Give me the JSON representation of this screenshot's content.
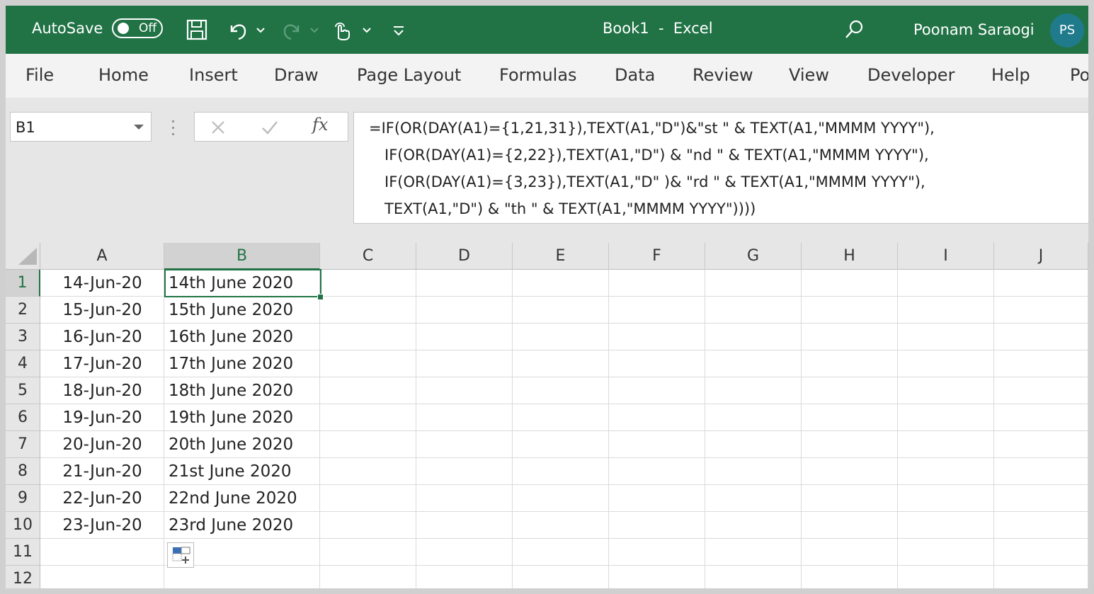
{
  "titlebar": {
    "autosave_label": "AutoSave",
    "autosave_state": "Off",
    "doc_title": "Book1  -  Excel",
    "user_name": "Poonam Saraogi",
    "user_initials": "PS",
    "icons": [
      "save-icon",
      "undo-icon",
      "redo-icon",
      "touch-mode-icon",
      "customize-toolbar-icon",
      "search-icon"
    ]
  },
  "ribbon": {
    "tabs": [
      "File",
      "Home",
      "Insert",
      "Draw",
      "Page Layout",
      "Formulas",
      "Data",
      "Review",
      "View",
      "Developer",
      "Help",
      "Po"
    ]
  },
  "formula_bar": {
    "name_box": "B1",
    "fx_label": "fx",
    "lines": [
      "=IF(OR(DAY(A1)={1,21,31}),TEXT(A1,\"D\")&\"st \" & TEXT(A1,\"MMMM YYYY\"),",
      "IF(OR(DAY(A1)={2,22}),TEXT(A1,\"D\") & \"nd \" & TEXT(A1,\"MMMM YYYY\"),",
      "IF(OR(DAY(A1)={3,23}),TEXT(A1,\"D\" )& \"rd \" & TEXT(A1,\"MMMM YYYY\"),",
      "TEXT(A1,\"D\") & \"th \" & TEXT(A1,\"MMMM YYYY\"))))"
    ]
  },
  "sheet": {
    "columns": [
      "A",
      "B",
      "C",
      "D",
      "E",
      "F",
      "G",
      "H",
      "I",
      "J"
    ],
    "rows": [
      "1",
      "2",
      "3",
      "4",
      "5",
      "6",
      "7",
      "8",
      "9",
      "10",
      "11",
      "12"
    ],
    "selected_cell": "B1",
    "col_a": [
      "14-Jun-20",
      "15-Jun-20",
      "16-Jun-20",
      "17-Jun-20",
      "18-Jun-20",
      "19-Jun-20",
      "20-Jun-20",
      "21-Jun-20",
      "22-Jun-20",
      "23-Jun-20"
    ],
    "col_b": [
      "14th June 2020",
      "15th June 2020",
      "16th June 2020",
      "17th June 2020",
      "18th June 2020",
      "19th June 2020",
      "20th June 2020",
      "21st June 2020",
      "22nd June 2020",
      "23rd June 2020"
    ]
  },
  "colors": {
    "accent": "#217346",
    "avatar": "#1f7a8c"
  }
}
